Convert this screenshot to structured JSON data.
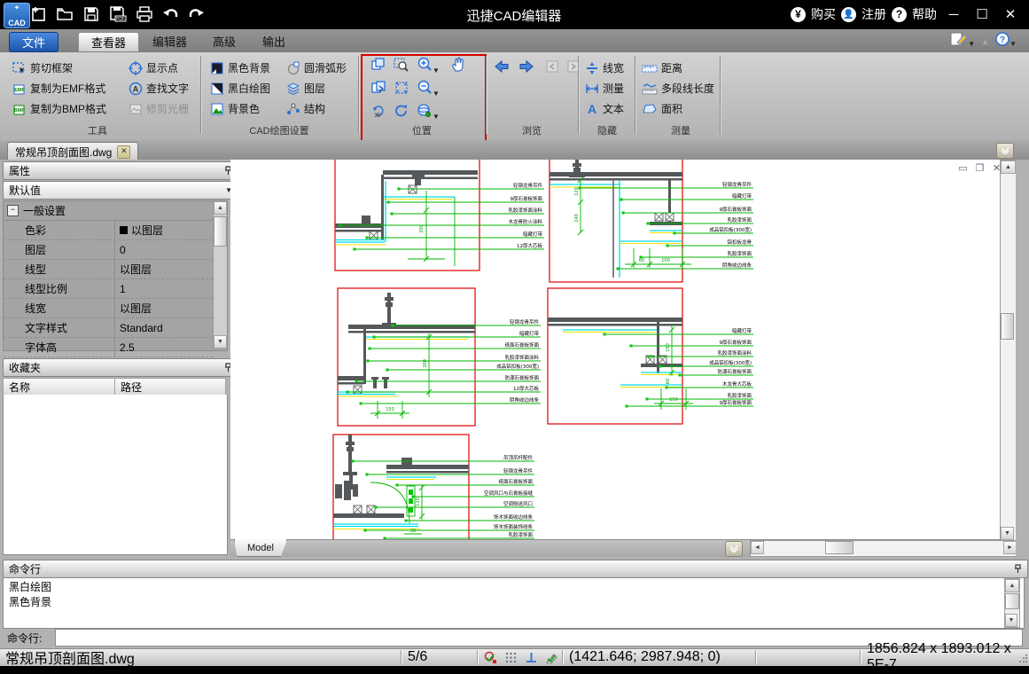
{
  "title_bar": {
    "app_title": "迅捷CAD编辑器",
    "buy": "购买",
    "register": "注册",
    "help": "帮助"
  },
  "menu_tabs": {
    "file": "文件",
    "viewer": "查看器",
    "editor": "编辑器",
    "advanced": "高级",
    "output": "输出"
  },
  "ribbon": {
    "tools": {
      "title": "工具",
      "cut_frame": "剪切框架",
      "copy_emf": "复制为EMF格式",
      "copy_bmp": "复制为BMP格式",
      "show_points": "显示点",
      "find_text": "查找文字",
      "trim_raster": "修剪光栅"
    },
    "cad_settings": {
      "title": "CAD绘图设置",
      "black_bg": "黑色背景",
      "bw_drawing": "黑白绘图",
      "bg_color": "背景色",
      "smooth_arc": "圆滑弧形",
      "layers": "图层",
      "structure": "结构"
    },
    "position": {
      "title": "位置"
    },
    "browse": {
      "title": "浏览"
    },
    "hide": {
      "title": "隐藏",
      "line_width": "线宽",
      "measure": "测量",
      "text": "文本"
    },
    "measure": {
      "title": "测量",
      "distance": "距离",
      "polyline_length": "多段线长度",
      "area": "面积"
    },
    "highlight_color": "#d40000"
  },
  "document_tab": {
    "name": "常规吊顶剖面图.dwg"
  },
  "properties_panel": {
    "title": "属性",
    "preset": "默认值",
    "group": "一般设置",
    "rows": [
      {
        "label": "色彩",
        "value": "以图层"
      },
      {
        "label": "图层",
        "value": "0"
      },
      {
        "label": "线型",
        "value": "以图层"
      },
      {
        "label": "线型比例",
        "value": "1"
      },
      {
        "label": "线宽",
        "value": "以图层"
      },
      {
        "label": "文字样式",
        "value": "Standard"
      },
      {
        "label": "字体高",
        "value": "2.5"
      }
    ]
  },
  "favorites_panel": {
    "title": "收藏夹",
    "col_name": "名称",
    "col_path": "路径"
  },
  "canvas": {
    "model_tab": "Model"
  },
  "drawings": {
    "v1": {
      "labels": [
        "轻钢龙骨吊件",
        "9厚石膏板饰面",
        "乳胶漆饰面涂料",
        "木龙骨防火涂料",
        "暗藏灯带",
        "12厚大芯板"
      ],
      "dim": "200"
    },
    "v2": {
      "labels": [
        "轻钢龙骨吊件",
        "暗藏灯带",
        "9厚石膏板饰面",
        "乳胶漆饰面",
        "成品铝扣板(300宽)",
        "铝扣板龙骨",
        "乳胶漆饰面",
        "阴角收边线条"
      ],
      "dim_v1": "120",
      "dim_v2": "240",
      "dim_b1": "60",
      "dim_b2": "100"
    },
    "v3": {
      "labels": [
        "轻钢龙骨吊件",
        "暗藏灯带",
        "纸面石膏板饰面",
        "乳胶漆饰面涂料",
        "成品铝扣板(300宽)",
        "防潮石膏板饰面",
        "12厚大芯板",
        "阴角收边线条"
      ],
      "dim_v": "200",
      "dim_b": "150"
    },
    "v4": {
      "labels": [
        "暗藏灯带",
        "9厚石膏板饰面",
        "乳胶漆饰面涂料",
        "成品铝扣板(300宽)",
        "防潮石膏板饰面",
        "木龙骨大芯板",
        "乳胶漆饰面",
        "9厚石膏板饰面"
      ],
      "dim_v1": "150",
      "dim_v2": "60",
      "dim_b": "150"
    },
    "v5": {
      "labels": [
        "吊顶吊杆配件",
        "轻钢龙骨吊件",
        "纸面石膏板饰面",
        "空调风口与石膏板接缝",
        "空调侧送风口",
        "饰木饰面收边线条",
        "饰木饰面装饰线条",
        "乳胶漆饰面"
      ],
      "dim_v": "120",
      "dim_b": "30"
    }
  },
  "command_panel": {
    "title": "命令行",
    "history": [
      "黑白绘图",
      "黑色背景"
    ],
    "prompt": "命令行:"
  },
  "status_bar": {
    "file": "常规吊顶剖面图.dwg",
    "page": "5/6",
    "coords": "(1421.646; 2987.948; 0)",
    "size": "1856.824 x 1893.012 x 5E-7"
  }
}
